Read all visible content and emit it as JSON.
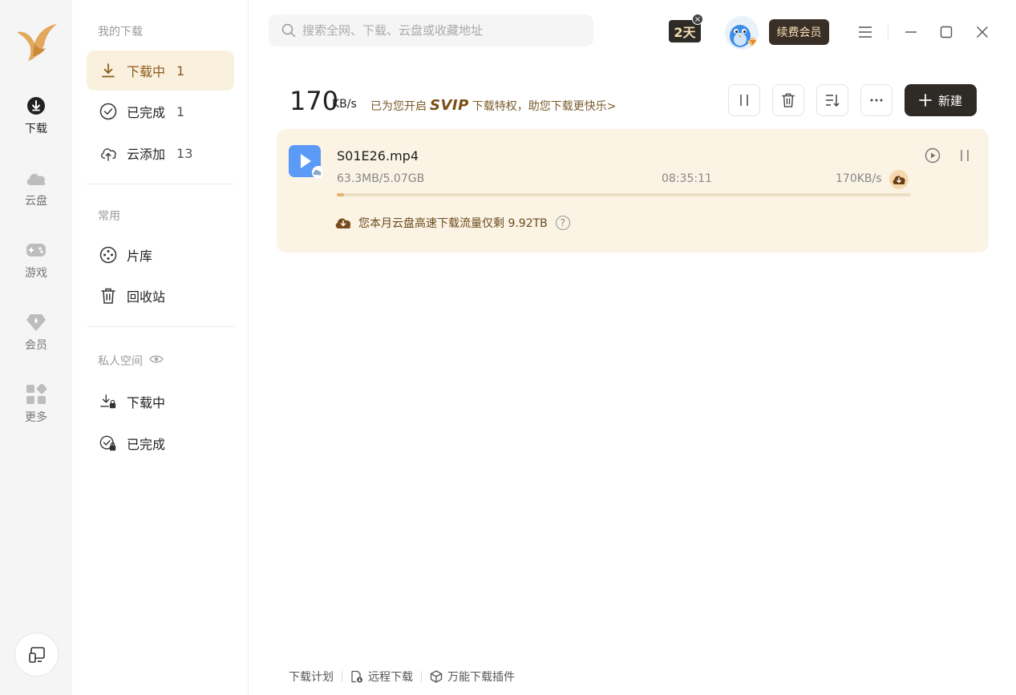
{
  "rail": {
    "items": [
      {
        "label": "下载",
        "icon": "download-circle-icon",
        "active": true
      },
      {
        "label": "云盘",
        "icon": "cloud-icon"
      },
      {
        "label": "游戏",
        "icon": "gamepad-icon"
      },
      {
        "label": "会员",
        "icon": "diamond-icon"
      },
      {
        "label": "更多",
        "icon": "grid-icon"
      }
    ]
  },
  "sidebar": {
    "my_downloads_title": "我的下载",
    "downloading": {
      "label": "下载中",
      "count": "1"
    },
    "completed": {
      "label": "已完成",
      "count": "1"
    },
    "cloud_add": {
      "label": "云添加",
      "count": "13"
    },
    "common_title": "常用",
    "library": {
      "label": "片库"
    },
    "recycle": {
      "label": "回收站"
    },
    "private_title": "私人空间",
    "private_downloading": {
      "label": "下载中"
    },
    "private_completed": {
      "label": "已完成"
    }
  },
  "search": {
    "placeholder": "搜索全网、下载、云盘或收藏地址"
  },
  "header": {
    "days_badge": "2天",
    "renew_label": "续费会员"
  },
  "toolbar": {
    "speed_value": "170",
    "speed_unit": "KB/s",
    "svip_prefix": "已为您开启",
    "svip_brand": "SVIP",
    "svip_suffix": "下载特权，助您下载更快乐>",
    "new_label": "新建"
  },
  "task": {
    "filename": "S01E26.mp4",
    "size": "63.3MB/5.07GB",
    "eta": "08:35:11",
    "speed": "170KB/s",
    "progress": 0.012,
    "quota_text": "您本月云盘高速下载流量仅剩 9.92TB",
    "help_glyph": "?"
  },
  "footer": {
    "plan": "下载计划",
    "remote": "远程下载",
    "plugin": "万能下载插件"
  },
  "colors": {
    "accent": "#8b5a1a",
    "active_bg": "#faf0de",
    "card_bg": "#fbf3e4",
    "dark_btn": "#2e2a26"
  }
}
